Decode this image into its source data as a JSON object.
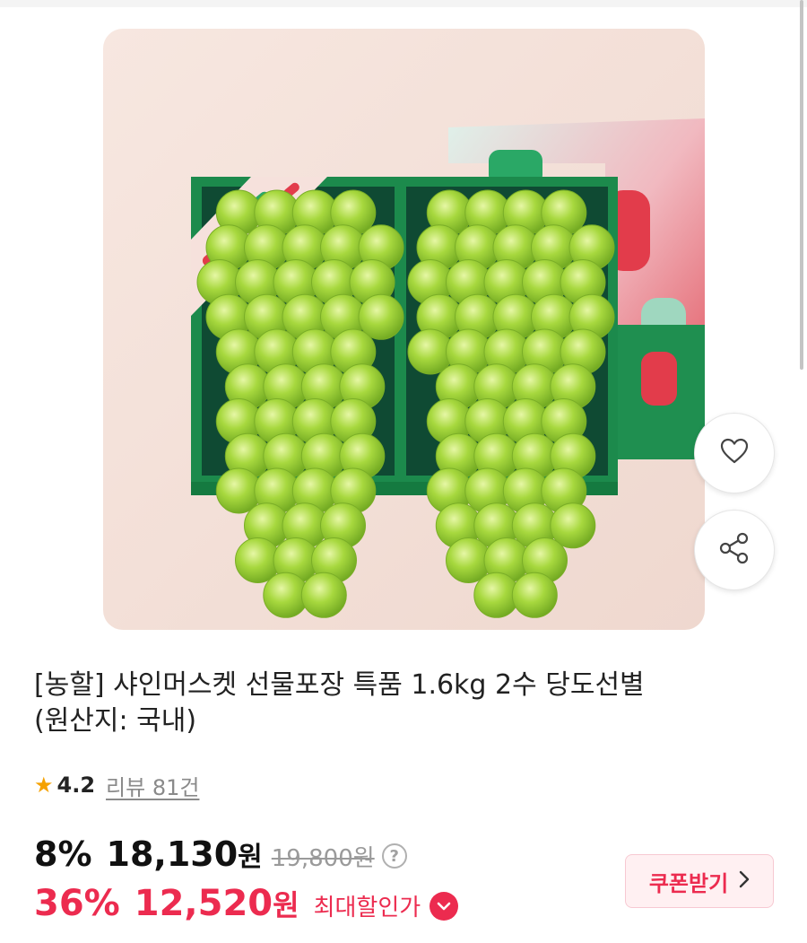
{
  "product": {
    "title_line1": "[농할] 샤인머스켓 선물포장 특품 1.6kg 2수 당도선별",
    "title_line2": "(원산지: 국내)",
    "image_alt": "샤인머스켓 선물포장"
  },
  "rating": {
    "star_icon": "★",
    "value": "4.2",
    "reviews_label": "리뷰 81건"
  },
  "price": {
    "discount_rate": "8%",
    "sale_price": "18,130",
    "currency": "원",
    "original_price": "19,800원",
    "help_icon": "?",
    "max_discount_rate": "36%",
    "max_price": "12,520",
    "max_label": "최대할인가"
  },
  "coupon": {
    "label": "쿠폰받기"
  },
  "actions": {
    "like_icon": "heart-icon",
    "share_icon": "share-icon"
  },
  "colors": {
    "accent": "#ec2b4f",
    "star": "#f5a100",
    "box_green": "#1c8a4c",
    "grape_green": "#9fd43a"
  }
}
